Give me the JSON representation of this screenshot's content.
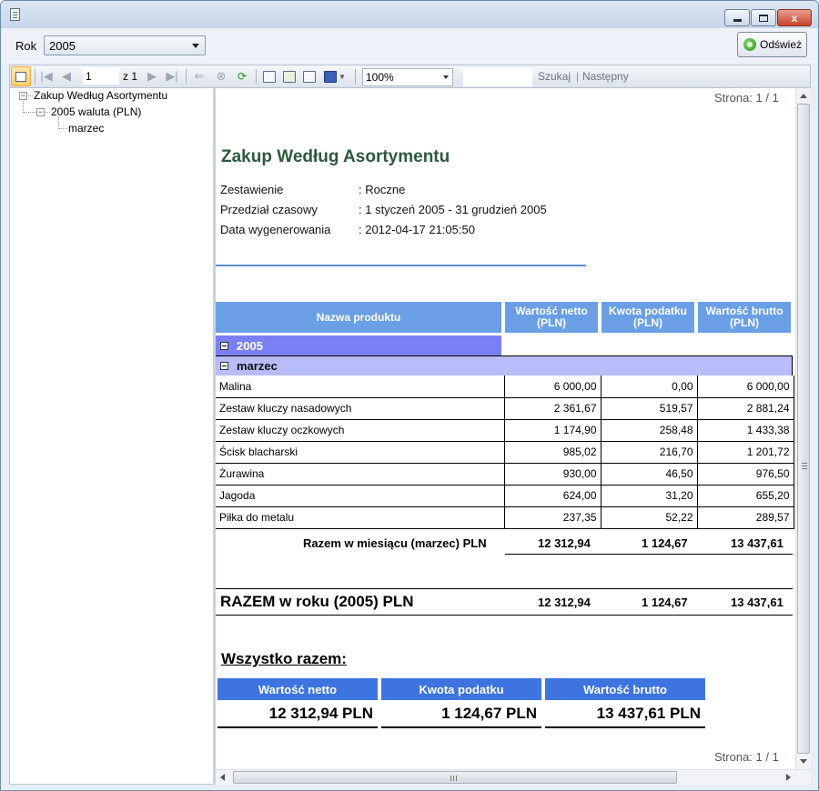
{
  "window": {
    "minimize_glyph": "",
    "maximize_glyph": "",
    "close_glyph": "x"
  },
  "topbar": {
    "rok_label": "Rok",
    "rok_value": "2005",
    "refresh_label": "Odśwież"
  },
  "toolbar": {
    "page_value": "1",
    "page_of": "z 1",
    "zoom_value": "100%",
    "search_label": "Szukaj",
    "search_sep": "|",
    "next_label": "Następny",
    "icons": [
      "tree-toggle-icon",
      "first-page-icon",
      "prev-page-icon",
      "next-page-icon",
      "last-page-icon",
      "back-icon",
      "stop-icon",
      "refresh-icon",
      "print-icon",
      "print-layout-icon",
      "page-setup-icon",
      "export-icon"
    ]
  },
  "tree": {
    "root": "Zakup Według Asortymentu",
    "child": "2005 waluta (PLN)",
    "leaf": "marzec"
  },
  "report": {
    "page_top": "Strona: 1 / 1",
    "page_bottom": "Strona: 1 / 1",
    "title": "Zakup Według Asortymentu",
    "meta": [
      {
        "key": "Zestawienie",
        "value": ": Roczne"
      },
      {
        "key": "Przedział czasowy",
        "value": ": 1 styczeń 2005 - 31 grudzień 2005"
      },
      {
        "key": "Data wygenerowania",
        "value": ": 2012-04-17 21:05:50"
      }
    ],
    "columns": {
      "name": "Nazwa produktu",
      "net": "Wartość netto (PLN)",
      "tax": "Kwota podatku (PLN)",
      "gross": "Wartość brutto (PLN)"
    },
    "group_year": "2005",
    "group_month": "marzec",
    "rows": [
      {
        "name": "Malina",
        "net": "6 000,00",
        "tax": "0,00",
        "gross": "6 000,00"
      },
      {
        "name": "Zestaw kluczy nasadowych",
        "net": "2 361,67",
        "tax": "519,57",
        "gross": "2 881,24"
      },
      {
        "name": "Zestaw kluczy oczkowych",
        "net": "1 174,90",
        "tax": "258,48",
        "gross": "1 433,38"
      },
      {
        "name": "Ścisk blacharski",
        "net": "985,02",
        "tax": "216,70",
        "gross": "1 201,72"
      },
      {
        "name": "Żurawina",
        "net": "930,00",
        "tax": "46,50",
        "gross": "976,50"
      },
      {
        "name": "Jagoda",
        "net": "624,00",
        "tax": "31,20",
        "gross": "655,20"
      },
      {
        "name": "Piłka do metalu",
        "net": "237,35",
        "tax": "52,22",
        "gross": "289,57"
      }
    ],
    "month_total": {
      "label": "Razem w miesiącu (marzec) PLN",
      "net": "12 312,94",
      "tax": "1 124,67",
      "gross": "13 437,61"
    },
    "year_total": {
      "label": "RAZEM w roku (2005) PLN",
      "net": "12 312,94",
      "tax": "1 124,67",
      "gross": "13 437,61"
    },
    "summary": {
      "title": "Wszystko razem:",
      "net_label": "Wartość netto",
      "tax_label": "Kwota podatku",
      "gross_label": "Wartość brutto",
      "net_value": "12 312,94 PLN",
      "tax_value": "1 124,67 PLN",
      "gross_value": "13 437,61 PLN"
    }
  },
  "colors": {
    "header_blue": "#6a9fe6",
    "year_band": "#7b7ff5",
    "month_band": "#b9bcfb",
    "summary_blue": "#3d74e0",
    "title_green": "#2d5a3c"
  }
}
